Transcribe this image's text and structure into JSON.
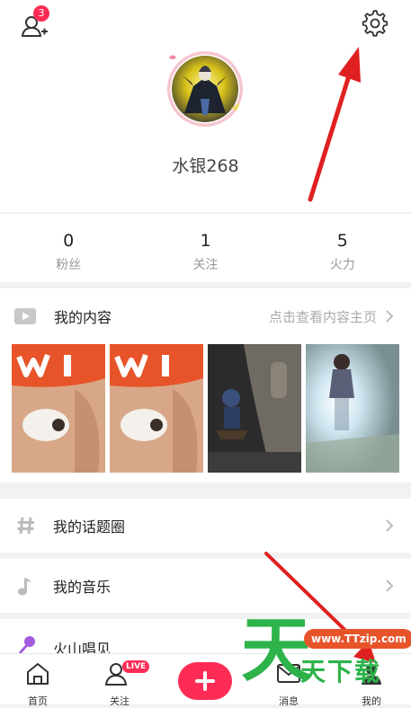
{
  "header": {
    "notification_badge": "3"
  },
  "profile": {
    "username": "水银268"
  },
  "stats": [
    {
      "value": "0",
      "label": "粉丝"
    },
    {
      "value": "1",
      "label": "关注"
    },
    {
      "value": "5",
      "label": "火力"
    }
  ],
  "my_content": {
    "title": "我的内容",
    "link": "点击查看内容主页"
  },
  "menu": {
    "topics": "我的话题圈",
    "music": "我的音乐",
    "karaoke": "火山唱见"
  },
  "tabbar": {
    "home": "首页",
    "follow": "关注",
    "live_badge": "LIVE",
    "messages": "消息",
    "me": "我的"
  },
  "watermark": {
    "url": "www.TTzip.com",
    "text": "天下载"
  },
  "colors": {
    "accent": "#fe2c55",
    "arrow": "#e02020",
    "watermark_green": "#2db34a"
  }
}
